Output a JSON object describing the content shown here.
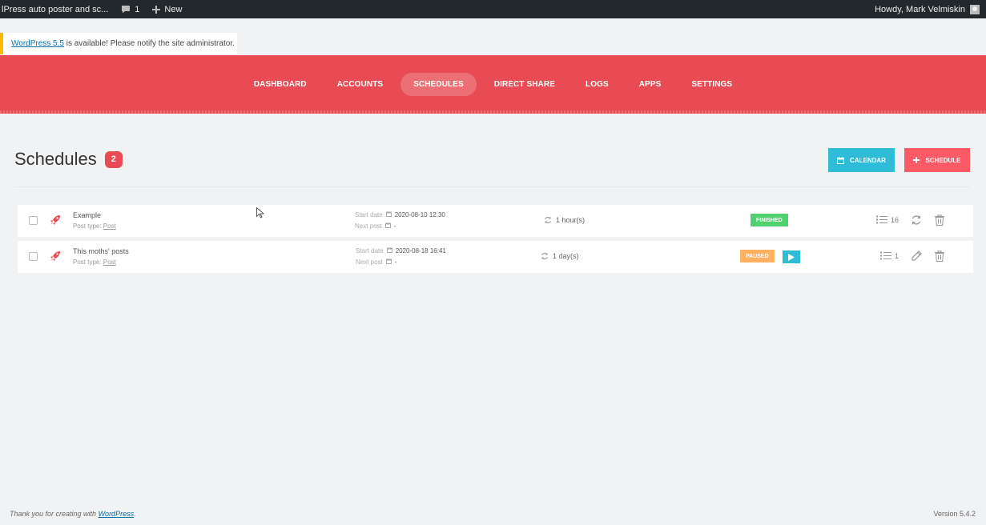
{
  "adminbar": {
    "site_title": "lPress auto poster and sc...",
    "comments_count": "1",
    "new_label": "New",
    "howdy": "Howdy, Mark Velmiskin"
  },
  "notice": {
    "link_text": "WordPress 5.5",
    "message": " is available! Please notify the site administrator."
  },
  "nav": {
    "items": [
      "DASHBOARD",
      "ACCOUNTS",
      "SCHEDULES",
      "DIRECT SHARE",
      "LOGS",
      "APPS",
      "SETTINGS"
    ],
    "active": "SCHEDULES"
  },
  "page": {
    "title": "Schedules",
    "count": "2",
    "calendar_button": "CALENDAR",
    "schedule_button": "SCHEDULE"
  },
  "schedules": [
    {
      "name": "Example",
      "post_type_label": "Post type: ",
      "post_type": "Post",
      "start_label": "Start date",
      "start_date": "2020-08-10 12:30",
      "next_label": "Next post",
      "next_post": "-",
      "interval": "1 hour(s)",
      "status": "FINISHED",
      "log_count": "16"
    },
    {
      "name": "This moths' posts",
      "post_type_label": "Post type: ",
      "post_type": "Post",
      "start_label": "Start date",
      "start_date": "2020-08-18 16:41",
      "next_label": "Next post",
      "next_post": "-",
      "interval": "1 day(s)",
      "status": "PAUSED",
      "log_count": "1"
    }
  ],
  "footer": {
    "thanks_prefix": "Thank you for creating with ",
    "thanks_link": "WordPress",
    "thanks_suffix": ".",
    "version": "Version 5.4.2"
  },
  "colors": {
    "nav_red": "#e84b54",
    "calendar_blue": "#2fbcd6",
    "schedule_red": "#fc5a64",
    "finished_green": "#4ed16e",
    "paused_orange": "#ffb060"
  }
}
